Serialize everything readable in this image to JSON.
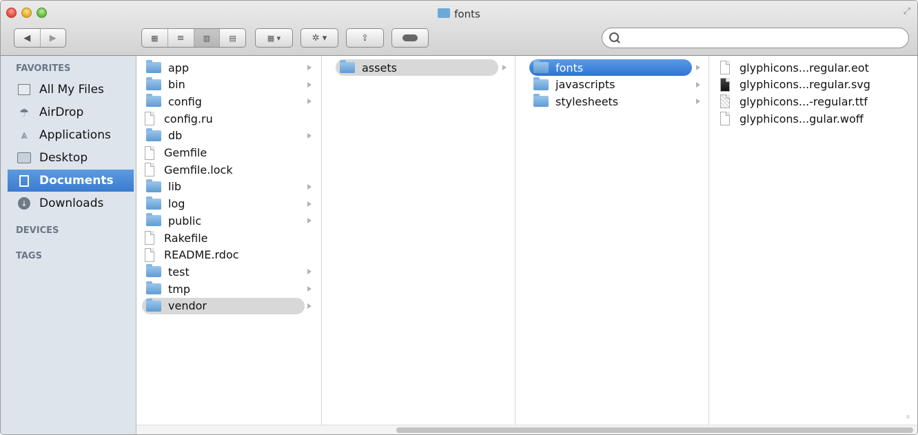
{
  "window": {
    "title": "fonts"
  },
  "toolbar": {
    "back_icon": "back-arrow-icon",
    "forward_icon": "forward-arrow-icon",
    "view_icons": [
      "icon-view-icon",
      "list-view-icon",
      "column-view-icon",
      "coverflow-view-icon"
    ],
    "arrange_icon": "arrange-icon",
    "action_icon": "gear-icon",
    "share_icon": "share-icon",
    "tags_icon": "tag-pill-icon"
  },
  "search": {
    "placeholder": "",
    "value": ""
  },
  "sidebar": {
    "favorites_heading": "FAVORITES",
    "items": [
      {
        "label": "All My Files",
        "icon": "all-files-icon"
      },
      {
        "label": "AirDrop",
        "icon": "airdrop-icon"
      },
      {
        "label": "Applications",
        "icon": "applications-icon"
      },
      {
        "label": "Desktop",
        "icon": "desktop-icon"
      },
      {
        "label": "Documents",
        "icon": "documents-icon",
        "selected": true
      },
      {
        "label": "Downloads",
        "icon": "downloads-icon"
      }
    ],
    "devices_heading": "DEVICES",
    "tags_heading": "TAGS"
  },
  "columns": [
    {
      "items": [
        {
          "name": "app",
          "kind": "folder",
          "arrow": true
        },
        {
          "name": "bin",
          "kind": "folder",
          "arrow": true
        },
        {
          "name": "config",
          "kind": "folder",
          "arrow": true
        },
        {
          "name": "config.ru",
          "kind": "file"
        },
        {
          "name": "db",
          "kind": "folder",
          "arrow": true
        },
        {
          "name": "Gemfile",
          "kind": "file"
        },
        {
          "name": "Gemfile.lock",
          "kind": "file"
        },
        {
          "name": "lib",
          "kind": "folder",
          "arrow": true
        },
        {
          "name": "log",
          "kind": "folder",
          "arrow": true
        },
        {
          "name": "public",
          "kind": "folder",
          "arrow": true
        },
        {
          "name": "Rakefile",
          "kind": "file"
        },
        {
          "name": "README.rdoc",
          "kind": "file"
        },
        {
          "name": "test",
          "kind": "folder",
          "arrow": true
        },
        {
          "name": "tmp",
          "kind": "folder",
          "arrow": true
        },
        {
          "name": "vendor",
          "kind": "folder",
          "arrow": true,
          "highlight": "grey"
        }
      ]
    },
    {
      "items": [
        {
          "name": "assets",
          "kind": "folder",
          "arrow": true,
          "highlight": "grey"
        }
      ]
    },
    {
      "items": [
        {
          "name": "fonts",
          "kind": "folder",
          "arrow": true,
          "highlight": "blue"
        },
        {
          "name": "javascripts",
          "kind": "folder",
          "arrow": true
        },
        {
          "name": "stylesheets",
          "kind": "folder",
          "arrow": true
        }
      ]
    },
    {
      "items": [
        {
          "name": "glyphicons...regular.eot",
          "kind": "file"
        },
        {
          "name": "glyphicons...regular.svg",
          "kind": "file-dark"
        },
        {
          "name": "glyphicons...-regular.ttf",
          "kind": "file-grey"
        },
        {
          "name": "glyphicons...gular.woff",
          "kind": "file"
        }
      ]
    }
  ]
}
